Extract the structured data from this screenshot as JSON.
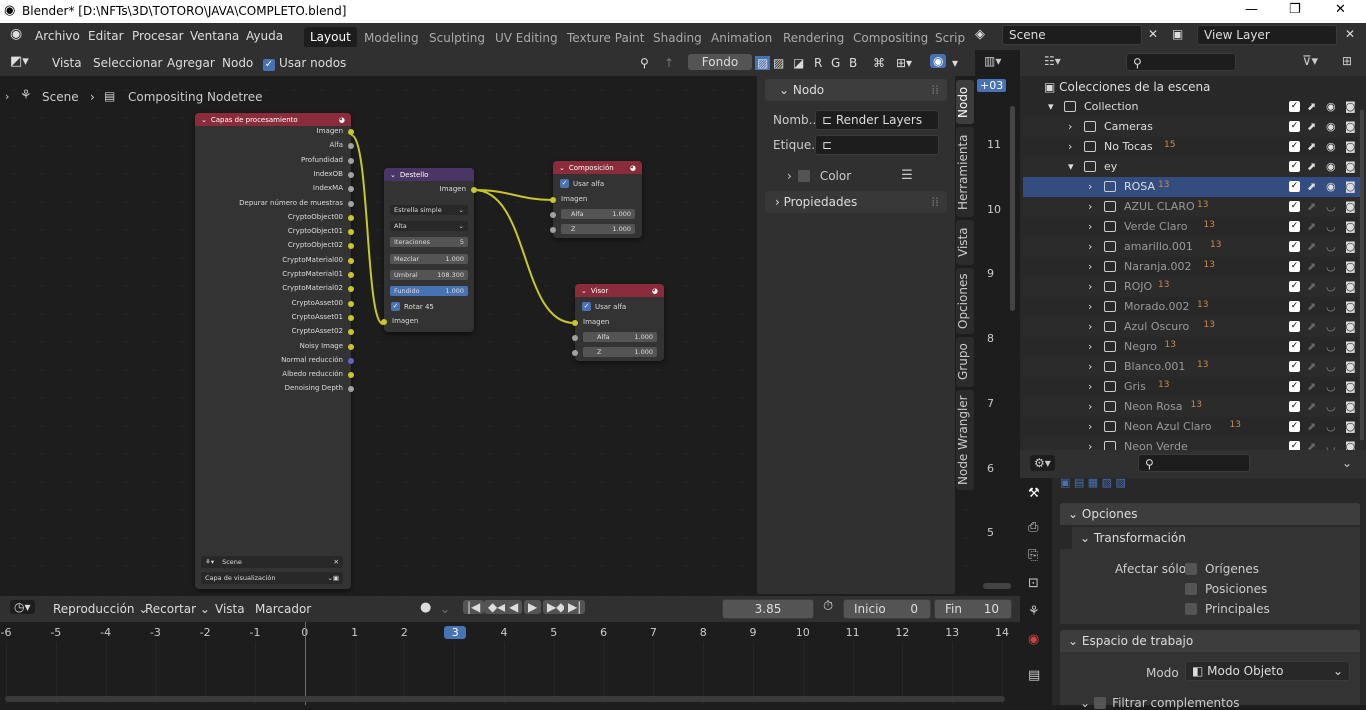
{
  "title_bar": {
    "title": "Blender* [D:\\NFTs\\3D\\TOTORO\\JAVA\\COMPLETO.blend]"
  },
  "menu": [
    "Archivo",
    "Editar",
    "Procesar",
    "Ventana",
    "Ayuda"
  ],
  "workspaces": [
    "Layout",
    "Modeling",
    "Sculpting",
    "UV Editing",
    "Texture Paint",
    "Shading",
    "Animation",
    "Rendering",
    "Compositing",
    "Scrip"
  ],
  "scene_field": "Scene",
  "view_layer_field": "View Layer",
  "node_header": {
    "menus": [
      "Vista",
      "Seleccionar",
      "Agregar",
      "Nodo"
    ],
    "use_nodes": "Usar nodos",
    "backdrop": "Fondo",
    "channels": [
      "R",
      "G",
      "B"
    ]
  },
  "breadcrumb": {
    "scene": "Scene",
    "tree": "Compositing Nodetree"
  },
  "nodes": {
    "render_layers": {
      "title": "Capas de procesamiento",
      "outputs": [
        "Imagen",
        "Alfa",
        "Profundidad",
        "IndexOB",
        "IndexMA",
        "Depurar número de muestras",
        "CryptoObject00",
        "CryptoObject01",
        "CryptoObject02",
        "CryptoMaterial00",
        "CryptoMaterial01",
        "CryptoMaterial02",
        "CryptoAsset00",
        "CryptoAsset01",
        "CryptoAsset02",
        "Noisy Image",
        "Normal reducción",
        "Albedo reducción",
        "Denoising Depth"
      ],
      "scene": "Scene",
      "layer": "Capa de visualización"
    },
    "glare": {
      "title": "Destello",
      "out": "Imagen",
      "type": "Estrella simple",
      "quality": "Alta",
      "iter_label": "Iteraciones",
      "iter_val": "5",
      "mix_label": "Mezclar",
      "mix_val": "1.000",
      "thr_label": "Umbral",
      "thr_val": "108.300",
      "fade_label": "Fundido",
      "fade_val": "1.000",
      "rot": "Rotar 45",
      "in": "Imagen"
    },
    "composite": {
      "title": "Composición",
      "use_alpha": "Usar alfa",
      "in": "Imagen",
      "alpha_label": "Alfa",
      "alpha_val": "1.000",
      "z_label": "Z",
      "z_val": "1.000"
    },
    "viewer": {
      "title": "Visor",
      "use_alpha": "Usar alfa",
      "in": "Imagen",
      "alpha_label": "Alfa",
      "alpha_val": "1.000",
      "z_label": "Z",
      "z_val": "1.000"
    }
  },
  "npanel": {
    "section": "Nodo",
    "name_label": "Nomb...",
    "name_val": "Render Layers",
    "label_label": "Etique...",
    "color": "Color",
    "properties": "Propiedades",
    "tabs": [
      "Nodo",
      "Herramienta",
      "Vista",
      "Opciones",
      "Grupo",
      "Node Wrangler"
    ]
  },
  "ruler": {
    "chip": "+03",
    "nums": [
      "11",
      "10",
      "9",
      "8",
      "7",
      "6",
      "5"
    ]
  },
  "outliner": {
    "root": "Colecciones de la escena",
    "rows": [
      {
        "name": "Collection",
        "badge": ""
      },
      {
        "name": "Cameras",
        "badge": ""
      },
      {
        "name": "No Tocas",
        "badge": "15"
      },
      {
        "name": "ey",
        "badge": ""
      },
      {
        "name": "ROSA",
        "badge": "13"
      },
      {
        "name": "AZUL CLARO",
        "badge": "13"
      },
      {
        "name": "Verde Claro",
        "badge": "13"
      },
      {
        "name": "amarillo.001",
        "badge": "13"
      },
      {
        "name": "Naranja.002",
        "badge": "13"
      },
      {
        "name": "ROJO",
        "badge": "13"
      },
      {
        "name": "Morado.002",
        "badge": "13"
      },
      {
        "name": "Azul Oscuro",
        "badge": "13"
      },
      {
        "name": "Negro",
        "badge": "13"
      },
      {
        "name": "Blanco.001",
        "badge": "13"
      },
      {
        "name": "Gris",
        "badge": "13"
      },
      {
        "name": "Neon Rosa",
        "badge": "13"
      },
      {
        "name": "Neon Azul Claro",
        "badge": "13"
      },
      {
        "name": "Neon Verde",
        "badge": ""
      }
    ]
  },
  "properties": {
    "opciones": "Opciones",
    "transformacion": "Transformación",
    "afectar": "Afectar sólo",
    "origenes": "Orígenes",
    "posiciones": "Posiciones",
    "principales": "Principales",
    "espacio": "Espacio de trabajo",
    "modo_label": "Modo",
    "modo_val": "Modo Objeto",
    "filtrar": "Filtrar complementos"
  },
  "timeline": {
    "menus": [
      "Reproducción",
      "Recortar",
      "Vista",
      "Marcador"
    ],
    "current": "3.85",
    "start_label": "Inicio",
    "start": "0",
    "end_label": "Fin",
    "end": "10",
    "ticks": [
      "-6",
      "-5",
      "-4",
      "-3",
      "-2",
      "-1",
      "0",
      "1",
      "2",
      "3",
      "4",
      "5",
      "6",
      "7",
      "8",
      "9",
      "10",
      "11",
      "12",
      "13",
      "14"
    ],
    "current_frame": "3"
  }
}
